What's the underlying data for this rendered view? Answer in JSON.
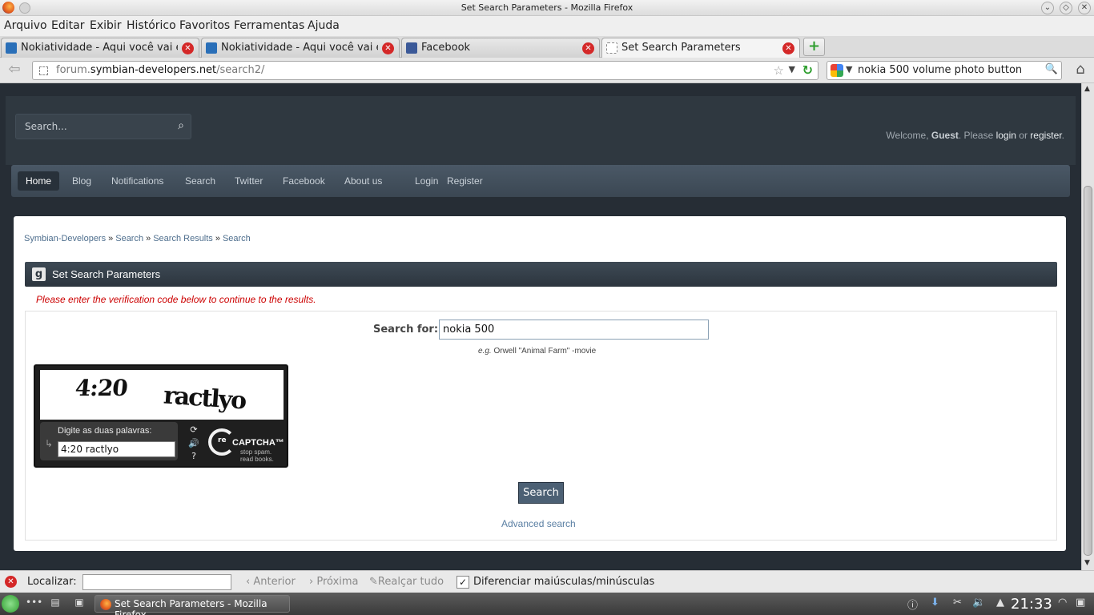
{
  "window": {
    "title": "Set Search Parameters - Mozilla Firefox"
  },
  "menu": [
    "Arquivo",
    "Editar",
    "Exibir",
    "Histórico",
    "Favoritos",
    "Ferramentas",
    "Ajuda"
  ],
  "tabs": [
    {
      "label": "Nokiatividade - Aqui você vai e...",
      "favicon": "nokiatividade-icon"
    },
    {
      "label": "Nokiatividade - Aqui você vai e...",
      "favicon": "nokiatividade-icon"
    },
    {
      "label": "Facebook",
      "favicon": "facebook-icon"
    },
    {
      "label": "Set Search Parameters",
      "favicon": "blank-page-icon"
    }
  ],
  "urlbar": {
    "domain_prefix": "forum.",
    "domain": "symbian-developers.net",
    "path": "/search2/"
  },
  "searchbar": {
    "value": "nokia 500 volume photo button"
  },
  "site": {
    "search_placeholder": "Search...",
    "welcome": {
      "prefix": "Welcome, ",
      "guest": "Guest",
      "mid": ". Please ",
      "login": "login",
      "or": " or ",
      "register": "register",
      "suffix": "."
    },
    "nav": [
      "Home",
      "Blog",
      "Notifications",
      "Search",
      "Twitter",
      "Facebook",
      "About us",
      "Login",
      "Register"
    ],
    "nav_active": "Home",
    "breadcrumb": [
      "Symbian-Developers",
      "Search",
      "Search Results",
      "Search"
    ],
    "breadcrumb_sep": "»",
    "panel_title": "Set Search Parameters",
    "panel_icon_letter": "g",
    "notice": "Please enter the verification code below to continue to the results.",
    "search_for_label": "Search for:",
    "search_for_value": "nokia 500",
    "example_prefix": "e.g.",
    "example_text": " Orwell \"Animal Farm\" -movie",
    "captcha": {
      "word1": "4:20",
      "word2": "ractlyo",
      "prompt": "Digite as duas palavras:",
      "value": "4:20 ractlyo",
      "logo_re": "re",
      "logo_title": "CAPTCHA™",
      "logo_tagline1": "stop spam.",
      "logo_tagline2": "read books."
    },
    "search_button": "Search",
    "advanced_link": "Advanced search"
  },
  "findbar": {
    "label": "Localizar:",
    "prev": "Anterior",
    "next": "Próxima",
    "highlight": "Realçar tudo",
    "match_case": "Diferenciar maiúsculas/minúsculas",
    "match_case_checked": true
  },
  "taskbar": {
    "task_label": "Set Search Parameters - Mozilla Firefox",
    "clock": "21:33"
  }
}
